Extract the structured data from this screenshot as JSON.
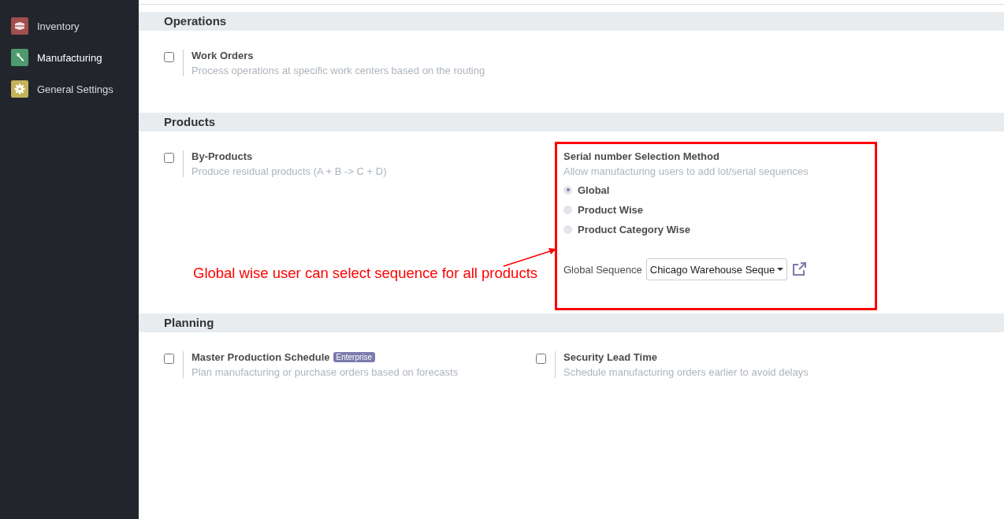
{
  "sidebar": {
    "items": [
      {
        "label": "Inventory",
        "kind": "inventory",
        "selected": false
      },
      {
        "label": "Manufacturing",
        "kind": "manufacturing",
        "selected": true
      },
      {
        "label": "General Settings",
        "kind": "settings",
        "selected": false
      }
    ]
  },
  "sections": [
    {
      "title": "Operations",
      "settings": [
        {
          "kind": "checkbox",
          "title": "Work Orders",
          "description": "Process operations at specific work centers based on the routing",
          "checked": false
        }
      ]
    },
    {
      "title": "Products",
      "settings": [
        {
          "kind": "checkbox",
          "title": "By-Products",
          "description": "Produce residual products (A + B -> C + D)",
          "checked": false
        },
        {
          "kind": "radio-group",
          "title": "Serial number Selection Method",
          "description": "Allow manufacturing users to add lot/serial sequences",
          "options": [
            {
              "label": "Global",
              "selected": true
            },
            {
              "label": "Product Wise",
              "selected": false
            },
            {
              "label": "Product Category Wise",
              "selected": false
            }
          ],
          "field": {
            "label": "Global Sequence",
            "value": "Chicago Warehouse Seque"
          }
        }
      ]
    },
    {
      "title": "Planning",
      "settings": [
        {
          "kind": "checkbox",
          "title": "Master Production Schedule",
          "badge": "Enterprise",
          "description": "Plan manufacturing or purchase orders based on forecasts",
          "checked": false
        },
        {
          "kind": "checkbox",
          "title": "Security Lead Time",
          "description": "Schedule manufacturing orders earlier to avoid delays",
          "checked": false
        }
      ]
    }
  ],
  "annotation": {
    "text": "Global wise user can select sequence for all products"
  }
}
